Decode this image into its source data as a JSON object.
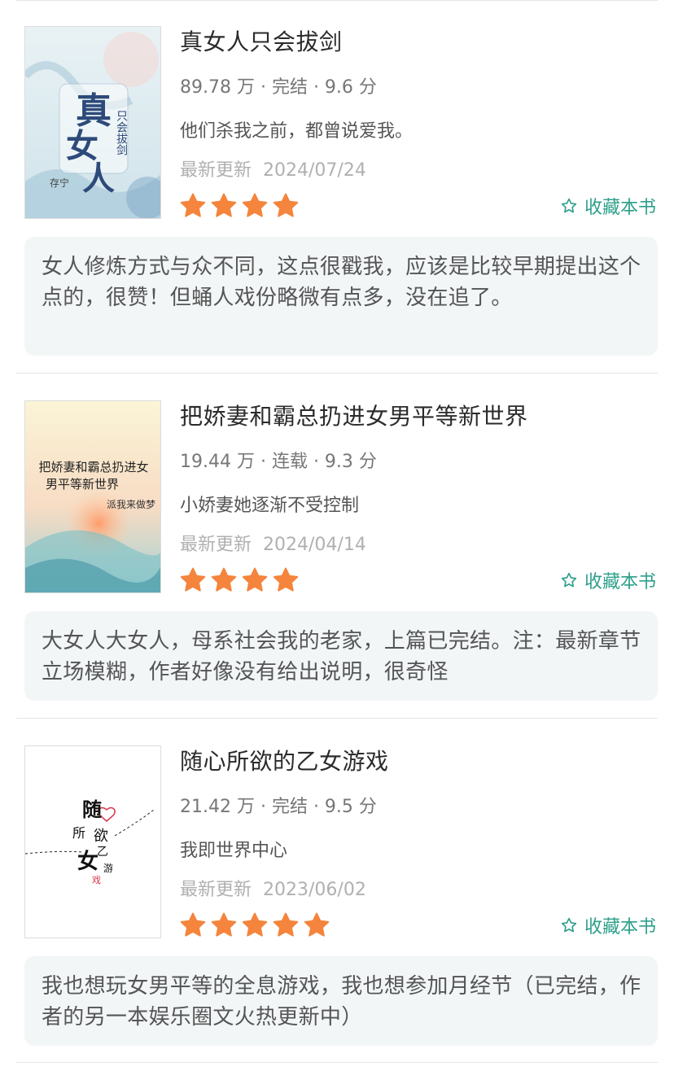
{
  "books": [
    {
      "title": "真女人只会拔剑",
      "meta": "89.78 万 · 完结 · 9.6 分",
      "summary": "他们杀我之前，都曾说爱我。",
      "update_label": "最新更新",
      "update_date": "2024/07/24",
      "rating_stars": 4,
      "fav_label": "收藏本书",
      "review": "女人修炼方式与众不同，这点很戳我，应该是比较早期提出这个点的，很赞！但蛹人戏份略微有点多，没在追了。",
      "cover_text": "真女人只会拔剑",
      "cover_author": "存宁"
    },
    {
      "title": "把娇妻和霸总扔进女男平等新世界",
      "meta": "19.44 万 · 连载 · 9.3 分",
      "summary": "小娇妻她逐渐不受控制",
      "update_label": "最新更新",
      "update_date": "2024/04/14",
      "rating_stars": 4,
      "fav_label": "收藏本书",
      "review": "大女人大女人，母系社会我的老家，上篇已完结。注：最新章节立场模糊，作者好像没有给出说明，很奇怪",
      "cover_line1": "把娇妻和霸总扔进女",
      "cover_line2": "男平等新世界",
      "cover_author": "派我来做梦"
    },
    {
      "title": "随心所欲的乙女游戏",
      "meta": "21.42 万 · 完结 · 9.5 分",
      "summary": "我即世界中心",
      "update_label": "最新更新",
      "update_date": "2023/06/02",
      "rating_stars": 5,
      "fav_label": "收藏本书",
      "review": "我也想玩女男平等的全息游戏，我也想参加月经节（已完结，作者的另一本娱乐圈文火热更新中）",
      "cover_chars": [
        "随",
        "所",
        "欲",
        "乙",
        "女",
        "游",
        "戏"
      ]
    }
  ],
  "colors": {
    "star": "#f5843c",
    "accent": "#2d9f8a",
    "review_bg": "#f2f6f7"
  }
}
